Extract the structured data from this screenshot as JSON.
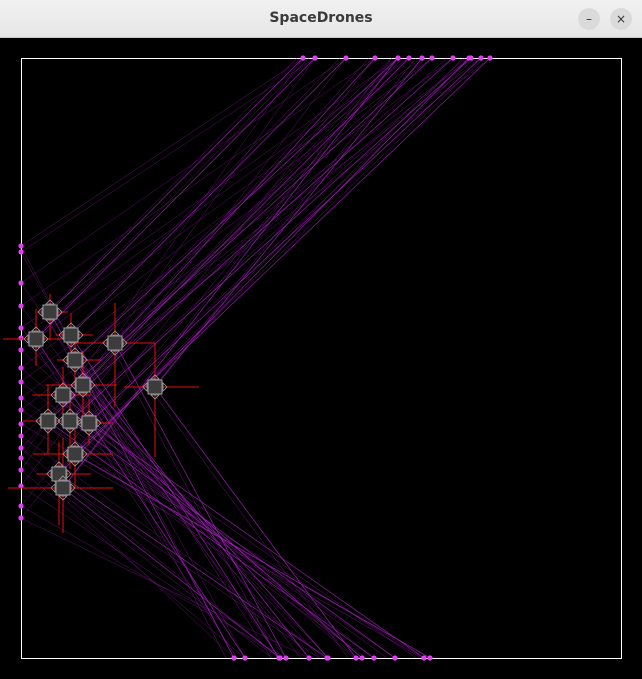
{
  "window": {
    "title": "SpaceDrones",
    "minimize_glyph": "–",
    "close_glyph": "×",
    "icons": {
      "minimize": "minimize-icon",
      "close": "close-icon"
    }
  },
  "colors": {
    "background": "#000000",
    "arena_border": "#ffffff",
    "trail": "#b020c8",
    "marker": "#e040f0",
    "drone_body": "#3c3c3c",
    "drone_outline": "#9a9a9a",
    "thrust": "#e01010"
  }
}
